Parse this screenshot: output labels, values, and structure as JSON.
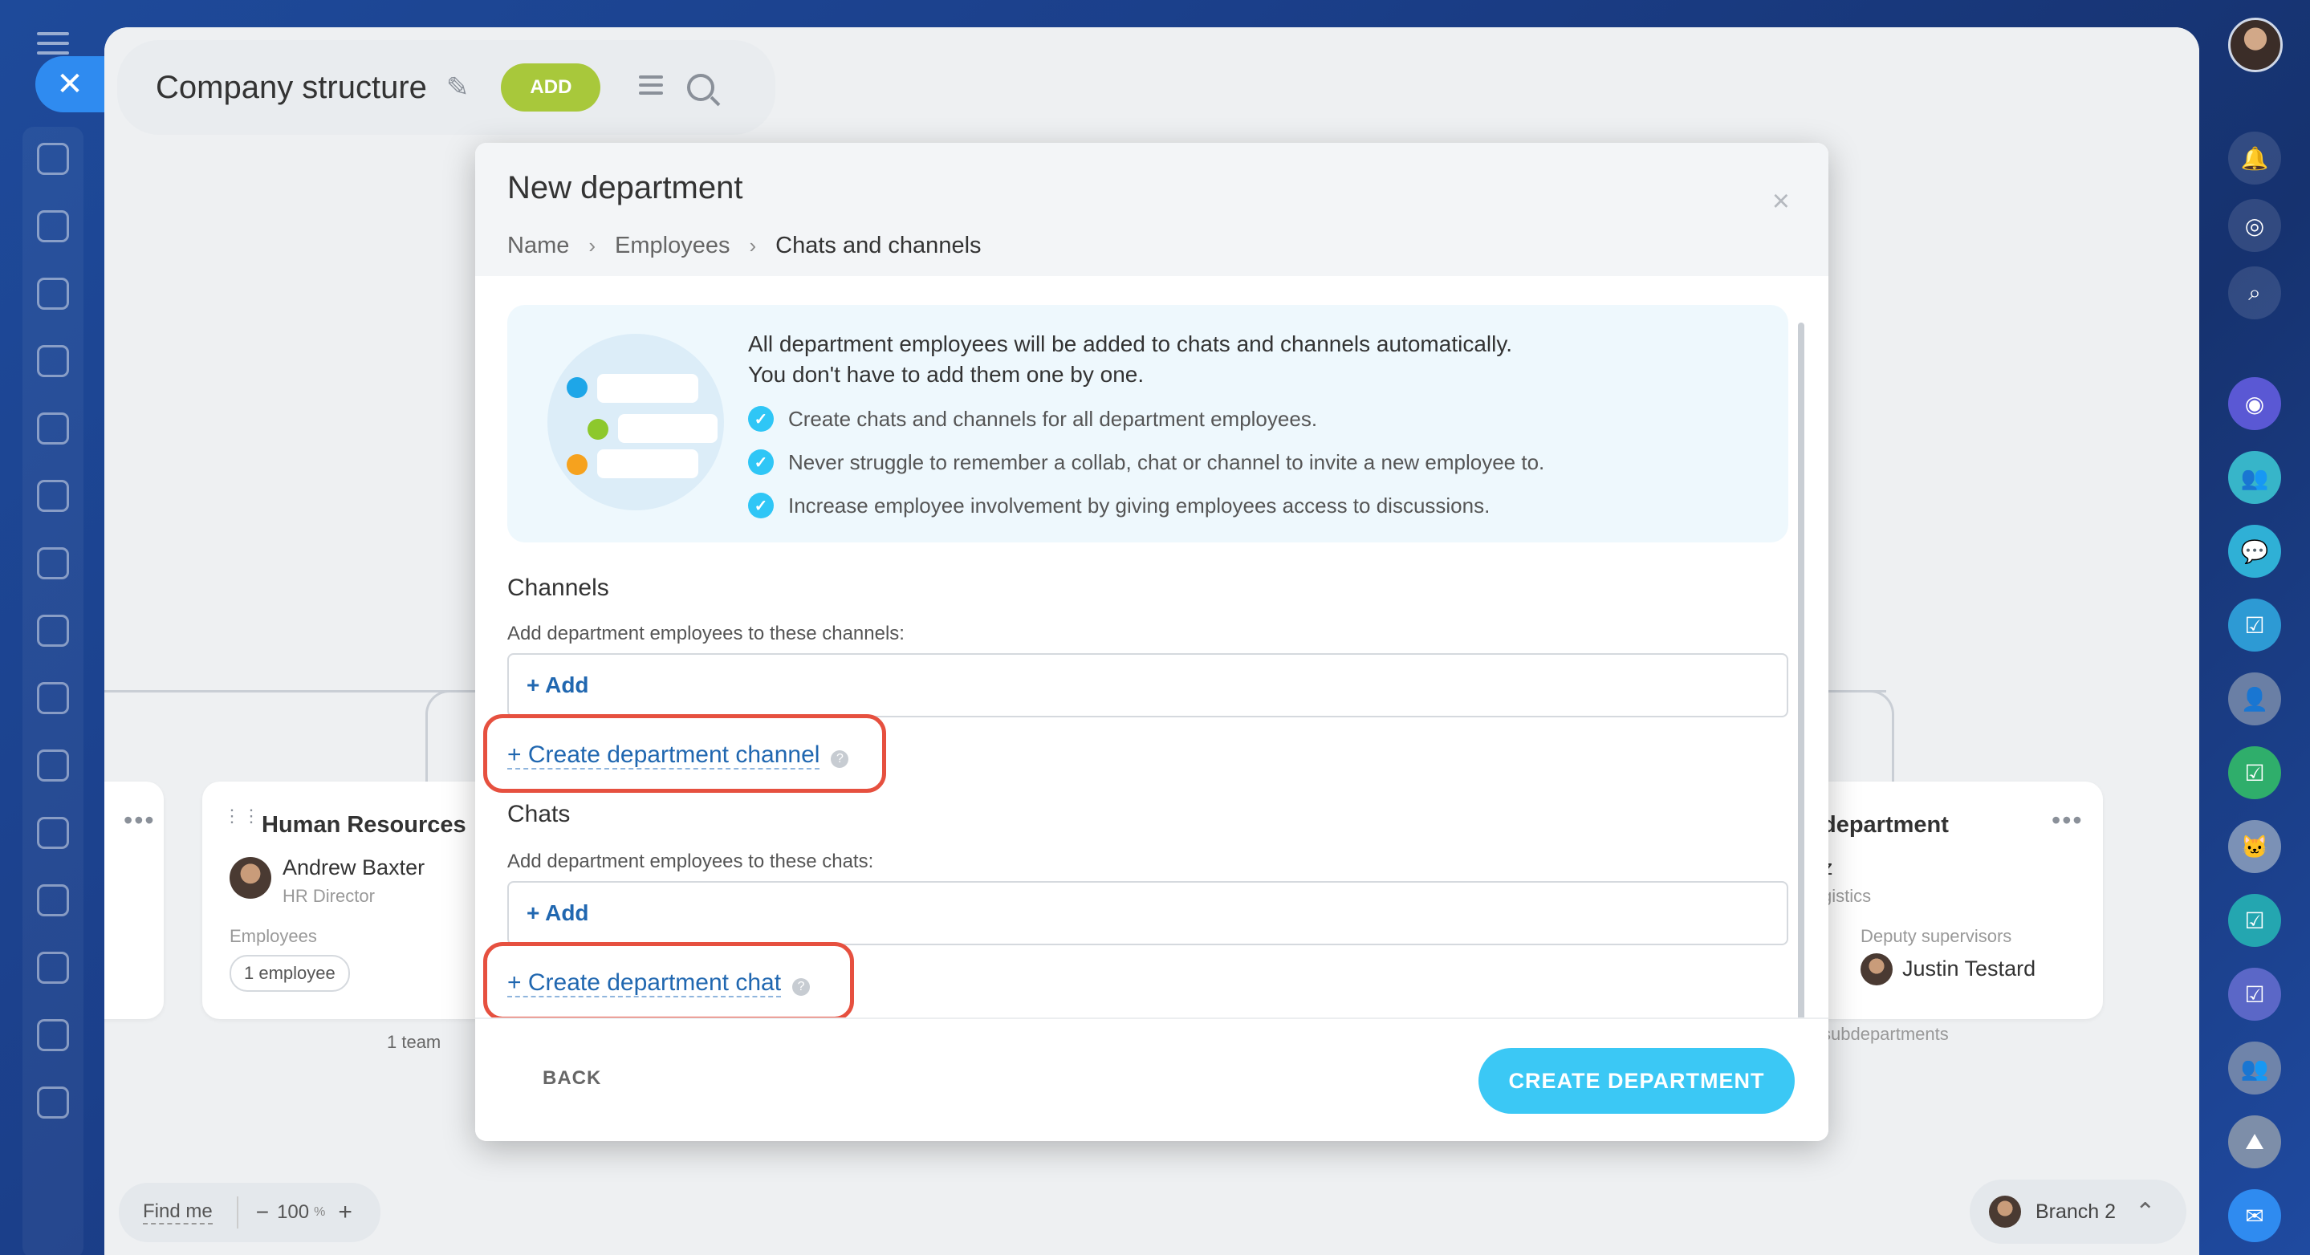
{
  "page": {
    "title": "Company structure",
    "add_label": "ADD"
  },
  "background_cards": {
    "hr_card": {
      "title": "Human Resources",
      "head_name": "Andrew Baxter",
      "head_role": "HR Director",
      "employees_label": "Employees",
      "employees_count": "1 employee",
      "teams": "1 team"
    },
    "right_card": {
      "title_fragment": "department",
      "name_fragment": "z",
      "role_fragment": "gistics",
      "deputy_label": "Deputy supervisors",
      "deputy_name": "Justin Testard",
      "sub_fragment": "subdepartments"
    }
  },
  "bottom_bar": {
    "find_me": "Find me",
    "zoom_minus": "−",
    "zoom_value": "100",
    "zoom_unit": "%",
    "zoom_plus": "+",
    "branch": "Branch 2"
  },
  "modal": {
    "title": "New department",
    "close": "×",
    "breadcrumbs": [
      "Name",
      "Employees",
      "Chats and channels"
    ],
    "breadcrumb_sep": "›",
    "info": {
      "line1": "All department employees will be added to chats and channels automatically.",
      "line2": "You don't have to add them one by one.",
      "bullets": [
        "Create chats and channels for all department employees.",
        "Never struggle to remember a collab, chat or channel to invite a new employee to.",
        "Increase employee involvement by giving employees access to discussions."
      ]
    },
    "channels": {
      "title": "Channels",
      "desc": "Add department employees to these channels:",
      "add": "+ Add",
      "create_link": "+ Create department channel"
    },
    "chats": {
      "title": "Chats",
      "desc": "Add department employees to these chats:",
      "add": "+ Add",
      "create_link": "+ Create department chat"
    },
    "back": "BACK",
    "create_button": "CREATE DEPARTMENT"
  },
  "colors": {
    "accent": "#3bc8f5",
    "link": "#2067b0",
    "highlight": "#e6503f",
    "add_green": "#a8c83b"
  }
}
